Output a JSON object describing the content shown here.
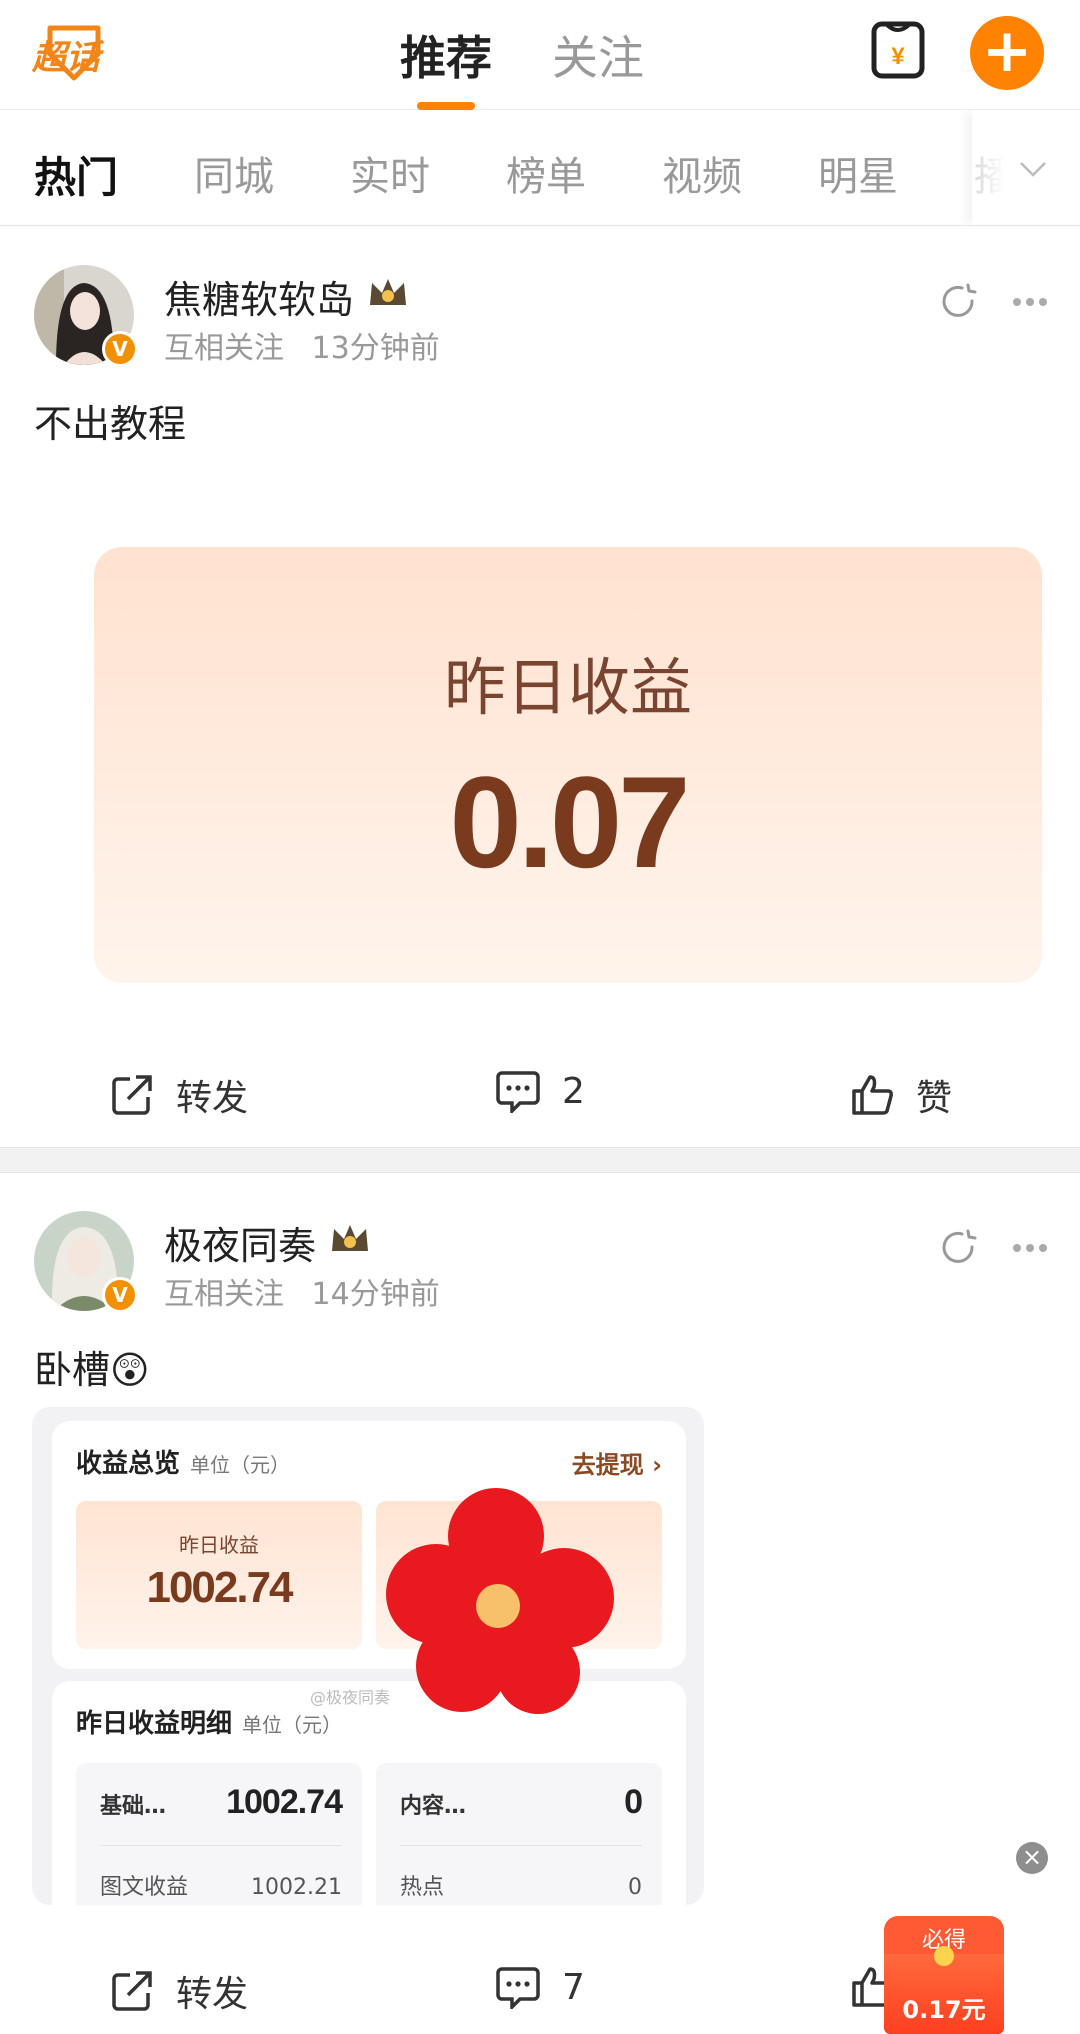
{
  "app": {
    "logo_text": "超话",
    "top_tabs": [
      "推荐",
      "关注"
    ],
    "active_top_tab": "推荐"
  },
  "sub_tabs": [
    "热门",
    "同城",
    "实时",
    "榜单",
    "视频",
    "明星",
    "播"
  ],
  "posts": [
    {
      "user": "焦糖软软岛",
      "relation": "互相关注",
      "time": "13分钟前",
      "text": "不出教程",
      "image": {
        "label": "昨日收益",
        "value": "0.07"
      },
      "actions": {
        "repost": "转发",
        "comments": "2",
        "like": "赞"
      }
    },
    {
      "user": "极夜同奏",
      "relation": "互相关注",
      "time": "14分钟前",
      "text": "卧槽😲",
      "image": {
        "overview_title": "收益总览",
        "overview_unit": "单位（元）",
        "withdraw_link": "去提现",
        "yesterday_label": "昨日收益",
        "yesterday_value": "1002.74",
        "watermark": "@极夜同奏",
        "detail_title": "昨日收益明细",
        "detail_unit": "单位（元）",
        "rows": [
          {
            "name": "基础…",
            "value": "1002.74",
            "sub_name": "图文收益",
            "sub_value": "1002.21"
          },
          {
            "name": "内容…",
            "value": "0",
            "sub_name": "热点",
            "sub_value": "0"
          }
        ]
      },
      "actions": {
        "repost": "转发",
        "comments": "7"
      }
    }
  ],
  "red_packet": {
    "label": "必得",
    "amount": "0.17元"
  },
  "colors": {
    "accent": "#ff8200",
    "earnings_text": "#7a3a1e",
    "earnings_bg": "#ffe2cf"
  }
}
